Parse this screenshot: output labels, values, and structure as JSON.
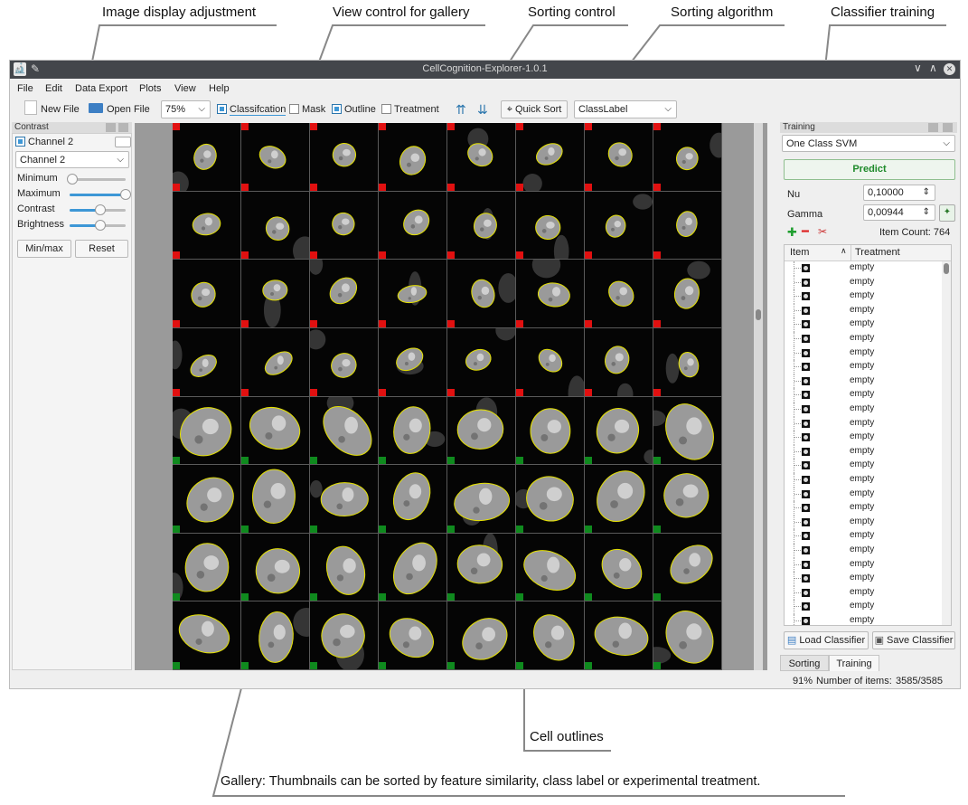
{
  "callouts": {
    "image_display": "Image display adjustment",
    "view_control": "View control for gallery",
    "sorting_control": "Sorting control",
    "sorting_algorithm": "Sorting algorithm",
    "classifier_training": "Classifier training",
    "cell_outlines": "Cell outlines",
    "gallery": "Gallery: Thumbnails can be sorted by feature similarity, class label or experimental treatment."
  },
  "window": {
    "title": "CellCognition-Explorer-1.0.1",
    "controls": [
      "∨",
      "∧",
      "✕"
    ]
  },
  "menu": [
    "File",
    "Edit",
    "Data Export",
    "Plots",
    "View",
    "Help"
  ],
  "toolbar": {
    "new_file": "New File",
    "open_file": "Open File",
    "zoom": "75%",
    "classification": "Classifcation",
    "mask": "Mask",
    "outline": "Outline",
    "treatment": "Treatment",
    "quick_sort": "Quick Sort",
    "sort_algorithm": "ClassLabel",
    "classification_checked": true,
    "mask_checked": false,
    "outline_checked": true,
    "treatment_checked": false
  },
  "contrast_panel": {
    "title": "Contrast",
    "channel_check": "Channel 2",
    "channel_select": "Channel 2",
    "sliders": [
      {
        "label": "Minimum",
        "value": 0.05
      },
      {
        "label": "Maximum",
        "value": 1.0
      },
      {
        "label": "Contrast",
        "value": 0.55
      },
      {
        "label": "Brightness",
        "value": 0.55
      }
    ],
    "minmax_button": "Min/max",
    "reset_button": "Reset"
  },
  "gallery": {
    "rows": 8,
    "cols": 8,
    "row_labels": [
      "red",
      "red",
      "red",
      "red",
      "green",
      "green",
      "green",
      "green"
    ],
    "label_colors": {
      "red": "#e11010",
      "green": "#0f8a1e"
    }
  },
  "training_panel": {
    "title": "Training",
    "classifier": "One Class SVM",
    "predict": "Predict",
    "nu_label": "Nu",
    "nu_value": "0,10000",
    "gamma_label": "Gamma",
    "gamma_value": "0,00944",
    "item_count": "Item Count: 764",
    "tree_headers": {
      "item": "Item",
      "treatment": "Treatment"
    },
    "items": [
      "empty",
      "empty",
      "empty",
      "empty",
      "empty",
      "empty",
      "empty",
      "empty",
      "empty",
      "empty",
      "empty",
      "empty",
      "empty",
      "empty",
      "empty",
      "empty",
      "empty",
      "empty",
      "empty",
      "empty",
      "empty",
      "empty",
      "empty",
      "empty",
      "empty",
      "empty"
    ],
    "load_classifier": "Load Classifier",
    "save_classifier": "Save Classifier"
  },
  "tabs": [
    "Sorting",
    "Training"
  ],
  "status": {
    "percent": "91%",
    "items_label": "Number of items:",
    "items_value": "3585/3585"
  }
}
